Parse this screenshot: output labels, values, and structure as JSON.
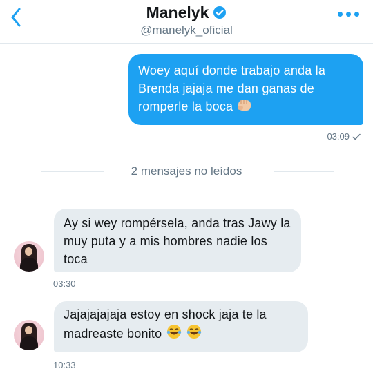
{
  "header": {
    "name": "Manelyk",
    "handle": "@manelyk_oficial",
    "icons": {
      "back": "chevron-left-icon",
      "verified": "verified-badge-icon",
      "more": "more-horizontal-icon"
    },
    "accent_color": "#1da1f2"
  },
  "messages": [
    {
      "direction": "outgoing",
      "text": "Woey aquí donde trabajo anda la Brenda jajaja me dan ganas de romperle la boca",
      "emoji": "fist-emoji",
      "time": "03:09",
      "status_icon": "check-icon"
    },
    {
      "direction": "incoming",
      "text": "Ay si wey rompérsela, anda tras Jawy la muy puta y a mis hombres nadie los toca",
      "time": "03:30",
      "avatar": "avatar"
    },
    {
      "direction": "incoming",
      "text": "Jajajajajaja estoy en shock jaja te la madreaste bonito",
      "emoji": "laughing-tears-emoji",
      "time": "10:33",
      "avatar": "avatar"
    }
  ],
  "divider": {
    "label": "2 mensajes no leídos"
  },
  "colors": {
    "outgoing_bubble": "#1da1f2",
    "incoming_bubble": "#e6ecf0",
    "secondary_text": "#657786"
  }
}
